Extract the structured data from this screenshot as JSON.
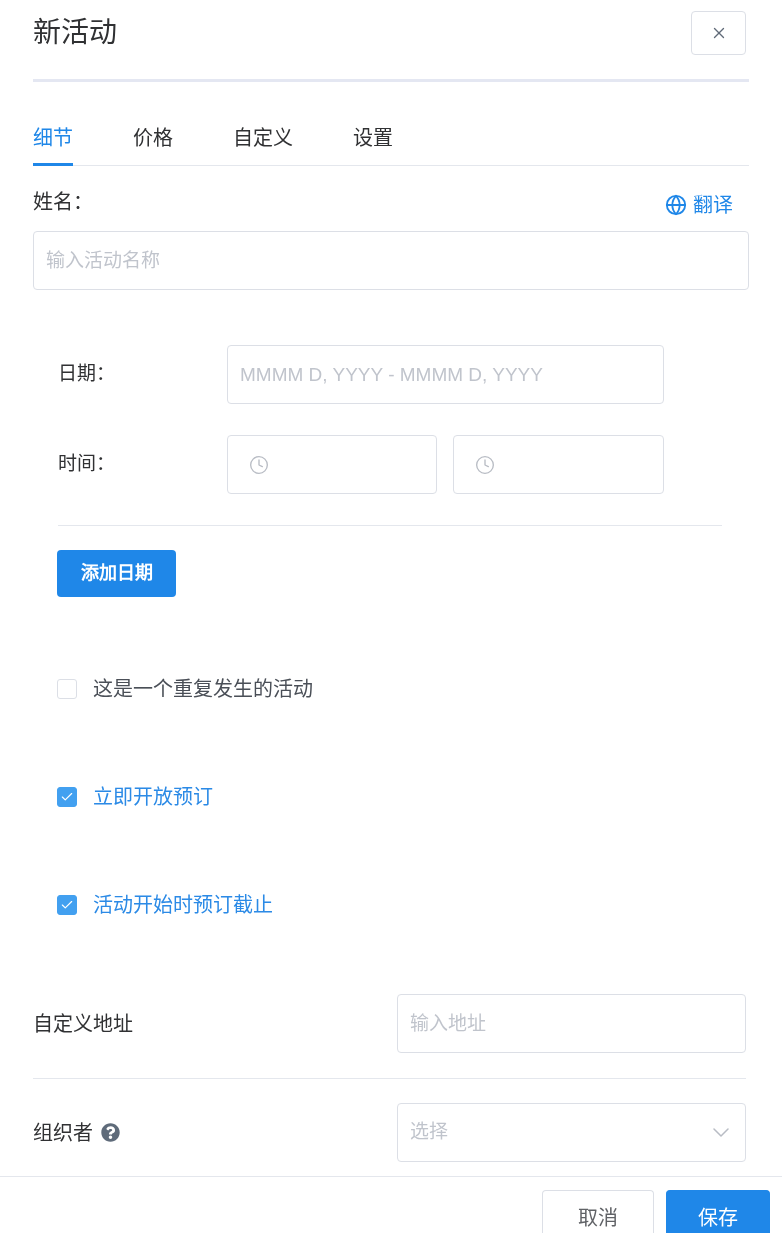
{
  "dialog": {
    "title": "新活动"
  },
  "tabs": [
    {
      "label": "细节",
      "selected": true
    },
    {
      "label": "价格",
      "selected": false
    },
    {
      "label": "自定义",
      "selected": false
    },
    {
      "label": "设置",
      "selected": false
    }
  ],
  "name_field": {
    "label": "姓名：",
    "translate_link": "翻译",
    "placeholder": "输入活动名称"
  },
  "schedule": {
    "date": {
      "label": "日期：",
      "placeholder": "MMMM D, YYYY - MMMM D, YYYY"
    },
    "time": {
      "label": "时间："
    },
    "add_button": "添加日期"
  },
  "options": [
    {
      "label": "这是一个重复发生的活动",
      "checked": false
    },
    {
      "label": "立即开放预订",
      "checked": true
    },
    {
      "label": "活动开始时预订截止",
      "checked": true
    }
  ],
  "custom_address": {
    "label": "自定义地址",
    "placeholder": "输入地址"
  },
  "organizer": {
    "label": "组织者",
    "placeholder": "选择"
  },
  "footer": {
    "buttons": [
      {
        "label": "取消",
        "kind": "secondary"
      },
      {
        "label": "保存",
        "kind": "primary"
      }
    ]
  }
}
